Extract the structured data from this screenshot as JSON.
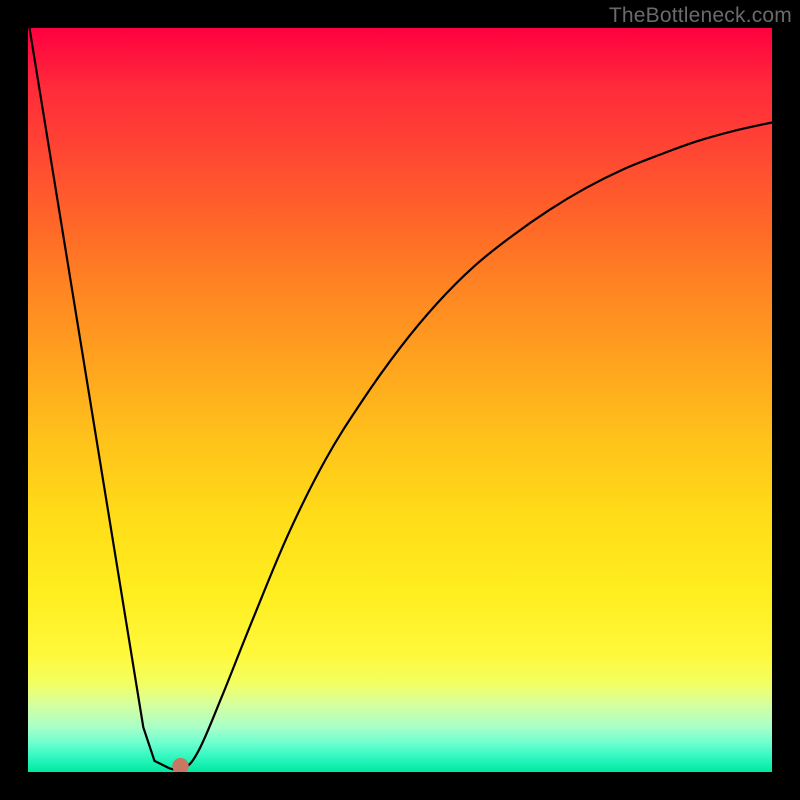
{
  "watermark": "TheBottleneck.com",
  "chart_data": {
    "type": "line",
    "title": "",
    "xlabel": "",
    "ylabel": "",
    "xlim": [
      0,
      100
    ],
    "ylim": [
      0,
      100
    ],
    "curve": [
      {
        "x": 0.2,
        "y": 100
      },
      {
        "x": 15.5,
        "y": 6
      },
      {
        "x": 17.0,
        "y": 1.5
      },
      {
        "x": 19.0,
        "y": 0.5
      },
      {
        "x": 21.0,
        "y": 0.5
      },
      {
        "x": 23.0,
        "y": 3
      },
      {
        "x": 26.0,
        "y": 10
      },
      {
        "x": 30.0,
        "y": 20
      },
      {
        "x": 35.0,
        "y": 32
      },
      {
        "x": 40.0,
        "y": 42
      },
      {
        "x": 45.0,
        "y": 50
      },
      {
        "x": 50.0,
        "y": 57
      },
      {
        "x": 55.0,
        "y": 63
      },
      {
        "x": 60.0,
        "y": 68
      },
      {
        "x": 65.0,
        "y": 72
      },
      {
        "x": 70.0,
        "y": 75.5
      },
      {
        "x": 75.0,
        "y": 78.5
      },
      {
        "x": 80.0,
        "y": 81
      },
      {
        "x": 85.0,
        "y": 83
      },
      {
        "x": 90.0,
        "y": 84.8
      },
      {
        "x": 95.0,
        "y": 86.2
      },
      {
        "x": 100.0,
        "y": 87.3
      }
    ],
    "marker": {
      "x": 20.5,
      "y": 0.8,
      "r_percent": 1.1
    },
    "background_gradient": {
      "top": "#ff0040",
      "mid": "#ffdd18",
      "bottom": "#00e8a0"
    }
  }
}
